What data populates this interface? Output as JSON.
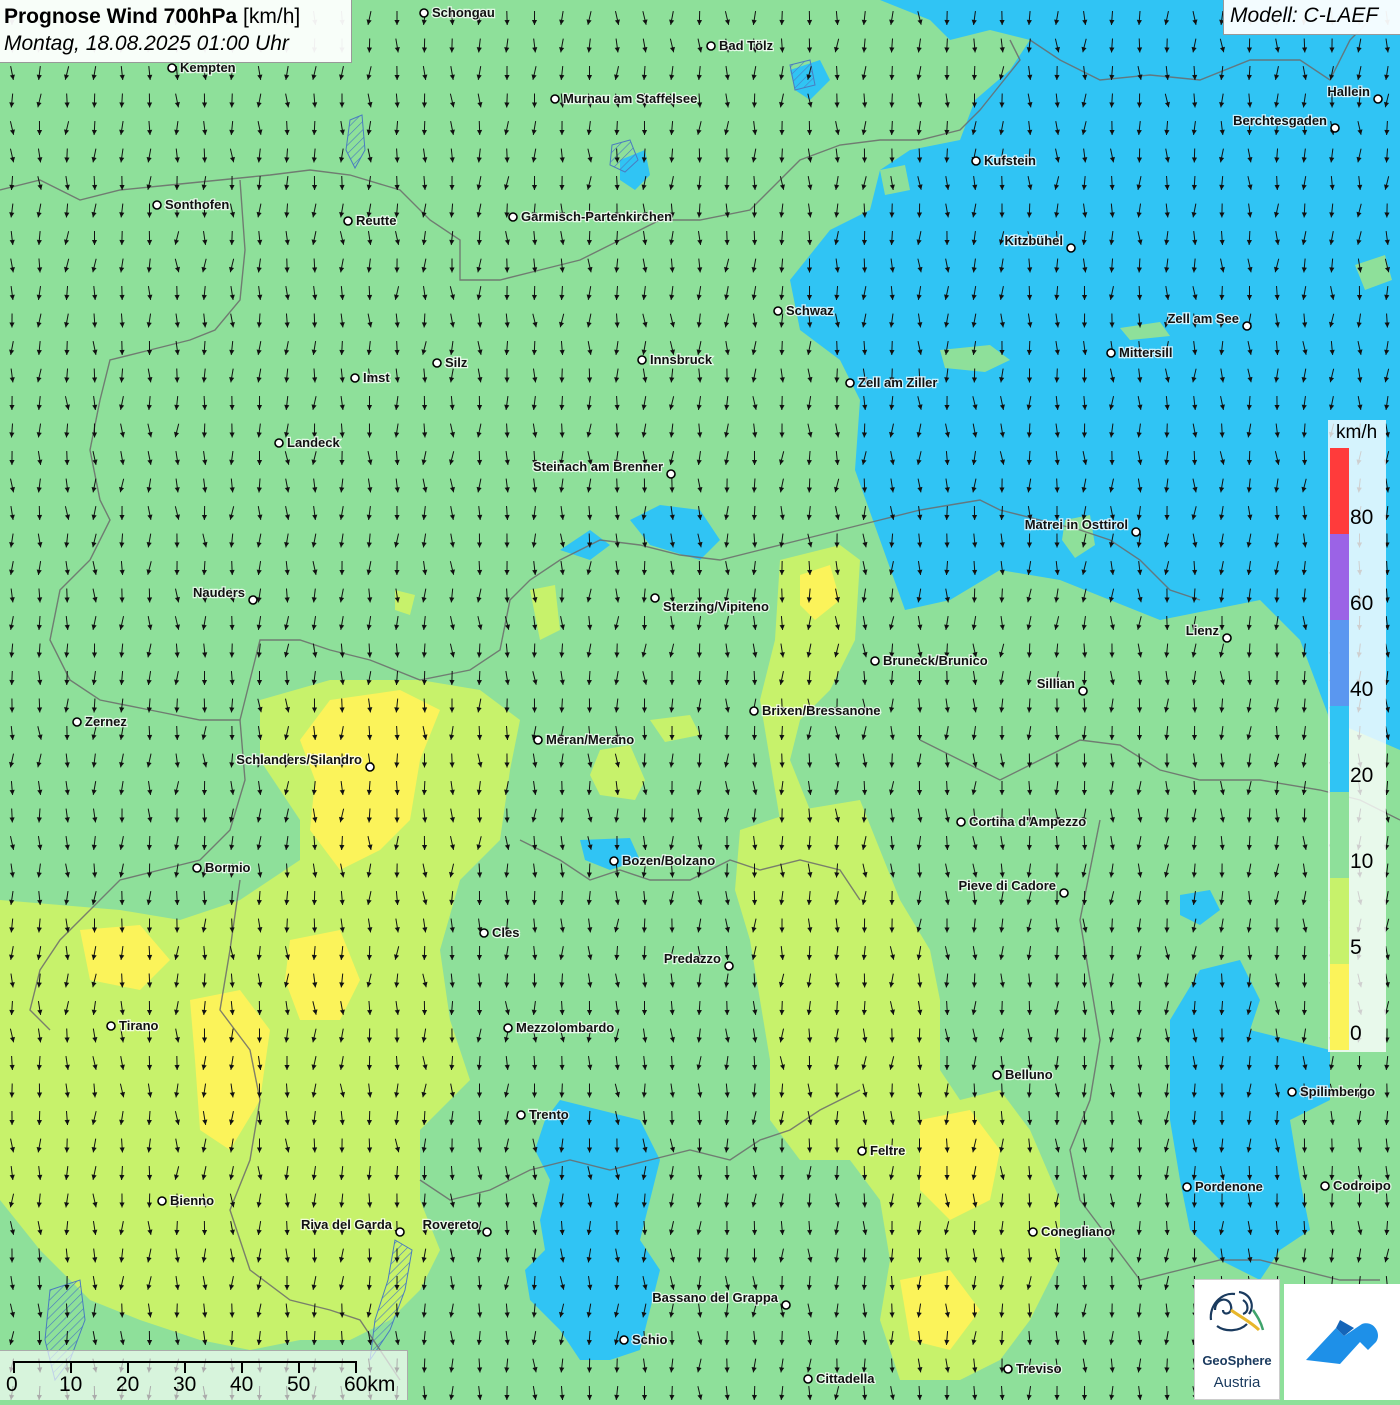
{
  "header": {
    "title_bold": "Prognose Wind 700hPa",
    "title_unit": "[km/h]",
    "datetime": "Montag, 18.08.2025 01:00 Uhr"
  },
  "model_label": "Modell: C-LAEF",
  "legend": {
    "unit": "km/h",
    "classes": [
      {
        "label": "80",
        "color": "#ff3b3b"
      },
      {
        "label": "60",
        "color": "#9b63e6"
      },
      {
        "label": "40",
        "color": "#5a97f0"
      },
      {
        "label": "20",
        "color": "#30c4f4"
      },
      {
        "label": "10",
        "color": "#8ee09a"
      },
      {
        "label": "5",
        "color": "#c7f26b"
      },
      {
        "label": "0",
        "color": "#fbf35a"
      }
    ],
    "top_color": "#ff3b3b"
  },
  "scale": {
    "labels": [
      "0",
      "10",
      "20",
      "30",
      "40",
      "50",
      "60km"
    ]
  },
  "logos": {
    "geosphere_line1": "GeoSphere",
    "geosphere_line2": "Austria"
  },
  "wind": {
    "direction": "south",
    "field_colors": {
      "calm": "#fbf35a",
      "light": "#c7f26b",
      "moderate": "#8ee09a",
      "fresh": "#30c4f4",
      "strong": "#5a97f0"
    }
  },
  "cities": [
    {
      "name": "Schongau"
    },
    {
      "name": "Bad Tölz"
    },
    {
      "name": "Kempten"
    },
    {
      "name": "Murnau am Staffelsee"
    },
    {
      "name": "Hallein"
    },
    {
      "name": "Berchtesgaden"
    },
    {
      "name": "Kufstein"
    },
    {
      "name": "Sonthofen"
    },
    {
      "name": "Reutte"
    },
    {
      "name": "Garmisch-Partenkirchen"
    },
    {
      "name": "Kitzbühel"
    },
    {
      "name": "Schwaz"
    },
    {
      "name": "Zell am See"
    },
    {
      "name": "Mittersill"
    },
    {
      "name": "Innsbruck"
    },
    {
      "name": "Silz"
    },
    {
      "name": "Imst"
    },
    {
      "name": "Zell am Ziller"
    },
    {
      "name": "Landeck"
    },
    {
      "name": "Steinach am Brenner"
    },
    {
      "name": "Matrei in Osttirol"
    },
    {
      "name": "Nauders"
    },
    {
      "name": "Sterzing/Vipiteno"
    },
    {
      "name": "Lienz"
    },
    {
      "name": "Bruneck/Brunico"
    },
    {
      "name": "Sillian"
    },
    {
      "name": "Zernez"
    },
    {
      "name": "Brixen/Bressanone"
    },
    {
      "name": "Meran/Merano"
    },
    {
      "name": "Schlanders/Silandro"
    },
    {
      "name": "Cortina d'Ampezzo"
    },
    {
      "name": "Bozen/Bolzano"
    },
    {
      "name": "Bormio"
    },
    {
      "name": "Pieve di Cadore"
    },
    {
      "name": "Cles"
    },
    {
      "name": "Predazzo"
    },
    {
      "name": "Tirano"
    },
    {
      "name": "Mezzolombardo"
    },
    {
      "name": "Belluno"
    },
    {
      "name": "Spilimbergo"
    },
    {
      "name": "Trento"
    },
    {
      "name": "Feltre"
    },
    {
      "name": "Bienno"
    },
    {
      "name": "Pordenone"
    },
    {
      "name": "Codroipo"
    },
    {
      "name": "Riva del Garda"
    },
    {
      "name": "Rovereto"
    },
    {
      "name": "Conegliano"
    },
    {
      "name": "Bassano del Grappa"
    },
    {
      "name": "Schio"
    },
    {
      "name": "Treviso"
    },
    {
      "name": "Cittadella"
    }
  ]
}
